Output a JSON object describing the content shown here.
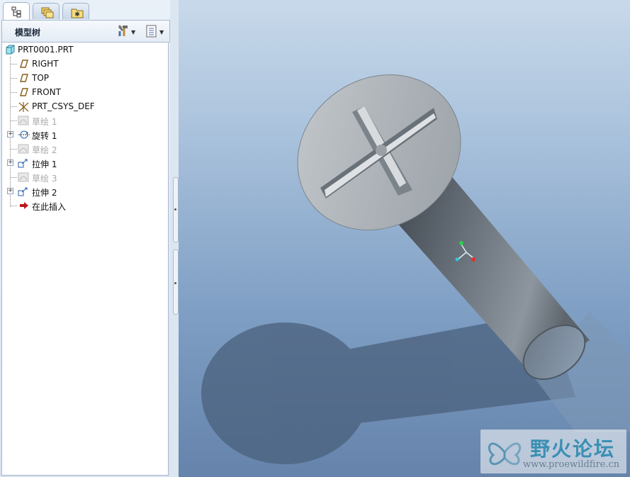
{
  "tabs": [
    {
      "name": "model-tree-tab",
      "icon": "tree-icon",
      "active": true
    },
    {
      "name": "layers-tab",
      "icon": "folders-icon",
      "active": false
    },
    {
      "name": "favorites-tab",
      "icon": "star-folder-icon",
      "active": false
    }
  ],
  "tree_header": {
    "title": "模型树",
    "settings_icon": "tools-icon",
    "show_icon": "list-icon"
  },
  "tree": {
    "root": "PRT0001.PRT",
    "items": [
      {
        "label": "RIGHT",
        "icon": "datum-plane-icon",
        "disabled": false,
        "expandable": false
      },
      {
        "label": "TOP",
        "icon": "datum-plane-icon",
        "disabled": false,
        "expandable": false
      },
      {
        "label": "FRONT",
        "icon": "datum-plane-icon",
        "disabled": false,
        "expandable": false
      },
      {
        "label": "PRT_CSYS_DEF",
        "icon": "csys-icon",
        "disabled": false,
        "expandable": false
      },
      {
        "label": "草绘 1",
        "icon": "sketch-icon",
        "disabled": true,
        "expandable": false
      },
      {
        "label": "旋转 1",
        "icon": "revolve-icon",
        "disabled": false,
        "expandable": true
      },
      {
        "label": "草绘 2",
        "icon": "sketch-icon",
        "disabled": true,
        "expandable": false
      },
      {
        "label": "拉伸 1",
        "icon": "extrude-icon",
        "disabled": false,
        "expandable": true
      },
      {
        "label": "草绘 3",
        "icon": "sketch-icon",
        "disabled": true,
        "expandable": false
      },
      {
        "label": "拉伸 2",
        "icon": "extrude-icon",
        "disabled": false,
        "expandable": true
      },
      {
        "label": "在此插入",
        "icon": "insert-arrow-icon",
        "disabled": false,
        "expandable": false
      }
    ]
  },
  "colors": {
    "insert_arrow": "#c0141c",
    "plane_icon": "#8a5a1a",
    "disabled_text": "#a8a8a8"
  },
  "watermark": {
    "title": "野火论坛",
    "url": "www.proewildfire.cn"
  }
}
